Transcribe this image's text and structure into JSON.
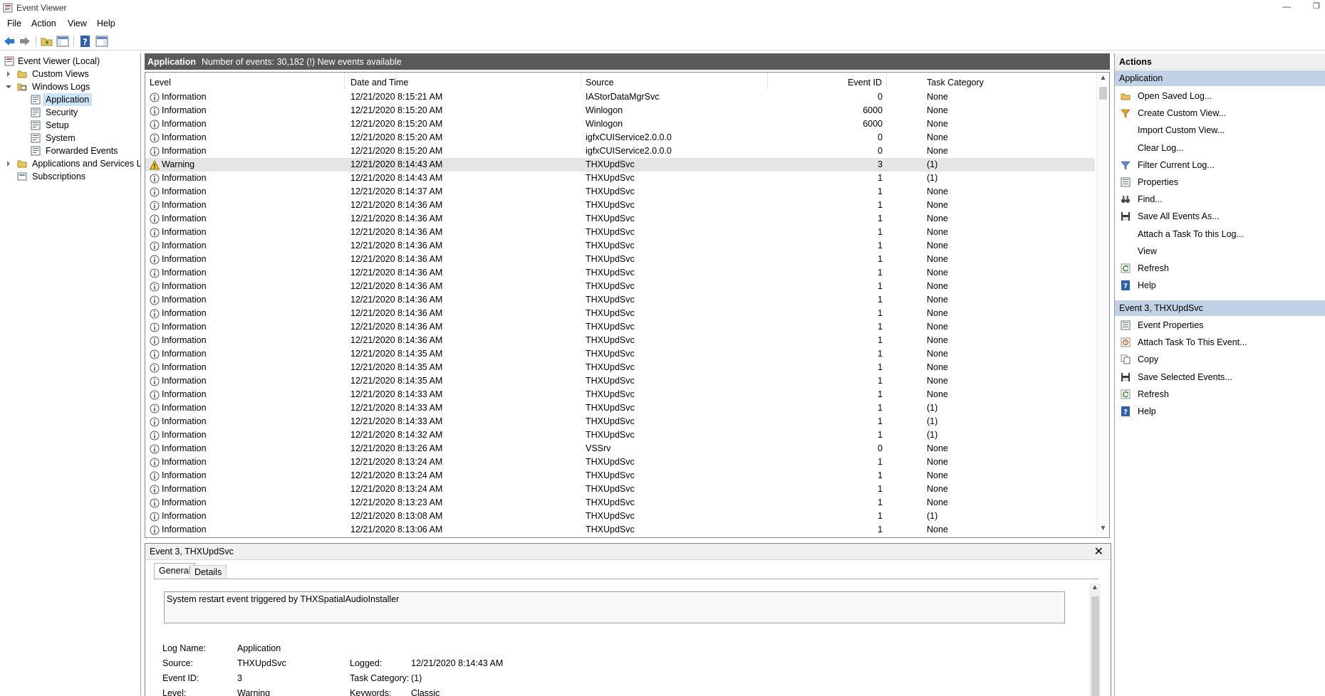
{
  "window": {
    "title": "Event Viewer"
  },
  "menu": [
    "File",
    "Action",
    "View",
    "Help"
  ],
  "tree": {
    "root": "Event Viewer (Local)",
    "custom_views": "Custom Views",
    "windows_logs": "Windows Logs",
    "logs": [
      "Application",
      "Security",
      "Setup",
      "System",
      "Forwarded Events"
    ],
    "apps_services": "Applications and Services Lo",
    "subscriptions": "Subscriptions"
  },
  "center": {
    "title": "Application",
    "info": "Number of events: 30,182 (!) New events available",
    "columns": [
      "Level",
      "Date and Time",
      "Source",
      "Event ID",
      "Task Category"
    ],
    "rows": [
      [
        "Information",
        "12/21/2020 8:15:21 AM",
        "IAStorDataMgrSvc",
        "0",
        "None"
      ],
      [
        "Information",
        "12/21/2020 8:15:20 AM",
        "Winlogon",
        "6000",
        "None"
      ],
      [
        "Information",
        "12/21/2020 8:15:20 AM",
        "Winlogon",
        "6000",
        "None"
      ],
      [
        "Information",
        "12/21/2020 8:15:20 AM",
        "igfxCUIService2.0.0.0",
        "0",
        "None"
      ],
      [
        "Information",
        "12/21/2020 8:15:20 AM",
        "igfxCUIService2.0.0.0",
        "0",
        "None"
      ],
      [
        "Warning",
        "12/21/2020 8:14:43 AM",
        "THXUpdSvc",
        "3",
        "(1)"
      ],
      [
        "Information",
        "12/21/2020 8:14:43 AM",
        "THXUpdSvc",
        "1",
        "(1)"
      ],
      [
        "Information",
        "12/21/2020 8:14:37 AM",
        "THXUpdSvc",
        "1",
        "None"
      ],
      [
        "Information",
        "12/21/2020 8:14:36 AM",
        "THXUpdSvc",
        "1",
        "None"
      ],
      [
        "Information",
        "12/21/2020 8:14:36 AM",
        "THXUpdSvc",
        "1",
        "None"
      ],
      [
        "Information",
        "12/21/2020 8:14:36 AM",
        "THXUpdSvc",
        "1",
        "None"
      ],
      [
        "Information",
        "12/21/2020 8:14:36 AM",
        "THXUpdSvc",
        "1",
        "None"
      ],
      [
        "Information",
        "12/21/2020 8:14:36 AM",
        "THXUpdSvc",
        "1",
        "None"
      ],
      [
        "Information",
        "12/21/2020 8:14:36 AM",
        "THXUpdSvc",
        "1",
        "None"
      ],
      [
        "Information",
        "12/21/2020 8:14:36 AM",
        "THXUpdSvc",
        "1",
        "None"
      ],
      [
        "Information",
        "12/21/2020 8:14:36 AM",
        "THXUpdSvc",
        "1",
        "None"
      ],
      [
        "Information",
        "12/21/2020 8:14:36 AM",
        "THXUpdSvc",
        "1",
        "None"
      ],
      [
        "Information",
        "12/21/2020 8:14:36 AM",
        "THXUpdSvc",
        "1",
        "None"
      ],
      [
        "Information",
        "12/21/2020 8:14:36 AM",
        "THXUpdSvc",
        "1",
        "None"
      ],
      [
        "Information",
        "12/21/2020 8:14:35 AM",
        "THXUpdSvc",
        "1",
        "None"
      ],
      [
        "Information",
        "12/21/2020 8:14:35 AM",
        "THXUpdSvc",
        "1",
        "None"
      ],
      [
        "Information",
        "12/21/2020 8:14:35 AM",
        "THXUpdSvc",
        "1",
        "None"
      ],
      [
        "Information",
        "12/21/2020 8:14:33 AM",
        "THXUpdSvc",
        "1",
        "None"
      ],
      [
        "Information",
        "12/21/2020 8:14:33 AM",
        "THXUpdSvc",
        "1",
        "(1)"
      ],
      [
        "Information",
        "12/21/2020 8:14:33 AM",
        "THXUpdSvc",
        "1",
        "(1)"
      ],
      [
        "Information",
        "12/21/2020 8:14:32 AM",
        "THXUpdSvc",
        "1",
        "(1)"
      ],
      [
        "Information",
        "12/21/2020 8:13:26 AM",
        "VSSrv",
        "0",
        "None"
      ],
      [
        "Information",
        "12/21/2020 8:13:24 AM",
        "THXUpdSvc",
        "1",
        "None"
      ],
      [
        "Information",
        "12/21/2020 8:13:24 AM",
        "THXUpdSvc",
        "1",
        "None"
      ],
      [
        "Information",
        "12/21/2020 8:13:24 AM",
        "THXUpdSvc",
        "1",
        "None"
      ],
      [
        "Information",
        "12/21/2020 8:13:23 AM",
        "THXUpdSvc",
        "1",
        "None"
      ],
      [
        "Information",
        "12/21/2020 8:13:08 AM",
        "THXUpdSvc",
        "1",
        "(1)"
      ],
      [
        "Information",
        "12/21/2020 8:13:06 AM",
        "THXUpdSvc",
        "1",
        "None"
      ]
    ]
  },
  "detail": {
    "title": "Event 3, THXUpdSvc",
    "close": "✕",
    "tabs": [
      "General",
      "Details"
    ],
    "description": "System restart event triggered by THXSpatialAudioInstaller",
    "fields": {
      "log_name_label": "Log Name:",
      "log_name": "Application",
      "source_label": "Source:",
      "source": "THXUpdSvc",
      "logged_label": "Logged:",
      "logged": "12/21/2020 8:14:43 AM",
      "event_id_label": "Event ID:",
      "event_id": "3",
      "task_cat_label": "Task Category:",
      "task_cat": "(1)",
      "level_label": "Level:",
      "level": "Warning",
      "keywords_label": "Keywords:",
      "keywords": "Classic"
    }
  },
  "actions": {
    "header": "Actions",
    "section1": "Application",
    "items1": [
      "Open Saved Log...",
      "Create Custom View...",
      "Import Custom View...",
      "Clear Log...",
      "Filter Current Log...",
      "Properties",
      "Find...",
      "Save All Events As...",
      "Attach a Task To this Log...",
      "View",
      "Refresh",
      "Help"
    ],
    "section2": "Event 3, THXUpdSvc",
    "items2": [
      "Event Properties",
      "Attach Task To This Event...",
      "Copy",
      "Save Selected Events...",
      "Refresh",
      "Help"
    ]
  },
  "colors": {
    "selection": "#cce4f7",
    "header_dark": "#5a5a5a",
    "section_blue": "#c1d2e6",
    "warning_row": "#e5e5e5"
  }
}
